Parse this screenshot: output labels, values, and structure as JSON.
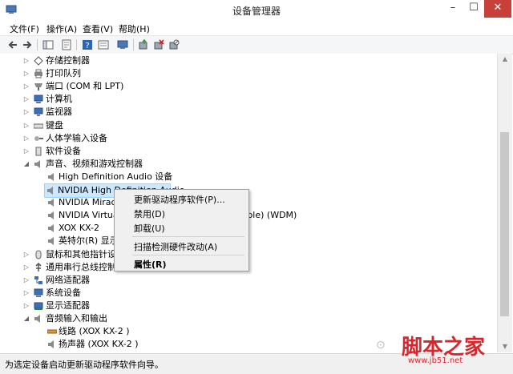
{
  "window": {
    "title": "设备管理器",
    "min": "–",
    "max": "☐",
    "close": "✕"
  },
  "menu": [
    "文件(F)",
    "操作(A)",
    "查看(V)",
    "帮助(H)"
  ],
  "tree": [
    {
      "label": "存储控制器",
      "icon": "storage-controller-icon",
      "expanded": false
    },
    {
      "label": "打印队列",
      "icon": "printer-icon",
      "expanded": false
    },
    {
      "label": "端口 (COM 和 LPT)",
      "icon": "port-icon",
      "expanded": false
    },
    {
      "label": "计算机",
      "icon": "computer-icon",
      "expanded": false
    },
    {
      "label": "监视器",
      "icon": "monitor-icon",
      "expanded": false
    },
    {
      "label": "键盘",
      "icon": "keyboard-icon",
      "expanded": false
    },
    {
      "label": "人体学输入设备",
      "icon": "hid-icon",
      "expanded": false
    },
    {
      "label": "软件设备",
      "icon": "software-device-icon",
      "expanded": false
    },
    {
      "label": "声音、视频和游戏控制器",
      "icon": "speaker-icon",
      "expanded": true
    },
    {
      "label": "High Definition Audio 设备",
      "icon": "speaker-icon",
      "child": true
    },
    {
      "label": "NVIDIA High Definition Audio",
      "icon": "speaker-icon",
      "child": true,
      "selected": true
    },
    {
      "label": "NVIDIA Miracast",
      "icon": "speaker-icon",
      "child": true
    },
    {
      "label": "NVIDIA Virtual Audio Device (Wave Extensible) (WDM)",
      "icon": "speaker-icon",
      "child": true
    },
    {
      "label": "XOX KX-2",
      "icon": "speaker-icon",
      "child": true
    },
    {
      "label": "英特尔(R) 显示器音频",
      "icon": "speaker-icon",
      "child": true
    },
    {
      "label": "鼠标和其他指针设备",
      "icon": "mouse-icon",
      "expanded": false
    },
    {
      "label": "通用串行总线控制器",
      "icon": "usb-icon",
      "expanded": false
    },
    {
      "label": "网络适配器",
      "icon": "network-icon",
      "expanded": false
    },
    {
      "label": "系统设备",
      "icon": "system-device-icon",
      "expanded": false
    },
    {
      "label": "显示适配器",
      "icon": "display-adapter-icon",
      "expanded": false
    },
    {
      "label": "音频输入和输出",
      "icon": "audio-io-icon",
      "expanded": true
    },
    {
      "label": "线路 (XOX KX-2 )",
      "icon": "line-in-icon",
      "child": true
    },
    {
      "label": "扬声器 (XOX KX-2 )",
      "icon": "speaker-icon",
      "child": true
    }
  ],
  "context_menu": {
    "update_driver": "更新驱动程序软件(P)...",
    "disable": "禁用(D)",
    "uninstall": "卸载(U)",
    "scan": "扫描检测硬件改动(A)",
    "properties": "属性(R)"
  },
  "status": "为选定设备启动更新驱动程序软件向导。",
  "watermark": {
    "text": "脚本之家",
    "url": "www.jb51.net"
  }
}
